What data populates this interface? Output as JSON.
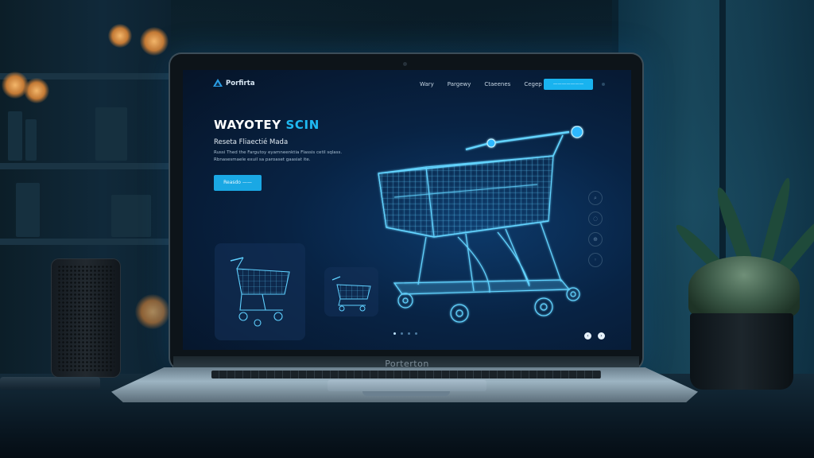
{
  "screen": {
    "logo": {
      "icon": "brand-logo-icon",
      "text": "Porfirta"
    },
    "nav": [
      "Wary",
      "Pargewy",
      "Ctaeenes",
      "Cegep"
    ],
    "top_button": "———————",
    "hero": {
      "title_main": "WAYOTEY ",
      "title_accent": "SCIN",
      "subtitle": "Reseta Fliaectié Mada",
      "paragraph": "Russi Thed the Fargutoy eyamneenktia Flassis cetil sqlass. Rbnasesmaele exuil sa paroaset gaasiat ite.",
      "button_label": "Reasdo   ——"
    },
    "side_icons": [
      "search-icon",
      "user-icon",
      "globe-icon",
      "cart-icon"
    ],
    "carousel": {
      "dots": 4,
      "active_index": 0
    },
    "controls": [
      "prev-icon",
      "next-icon"
    ],
    "accent_color": "#1fb9f2"
  },
  "laptop": {
    "brand_text": "Porterton"
  }
}
